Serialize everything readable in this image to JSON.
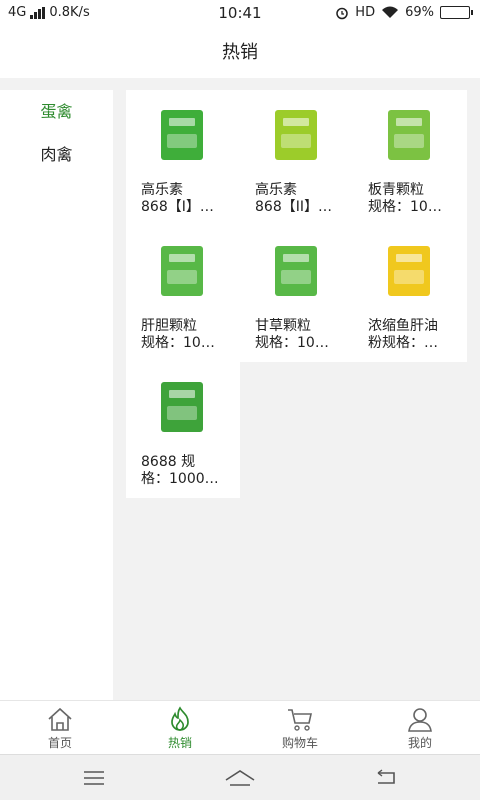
{
  "status_bar": {
    "network": "4G",
    "speed": "0.8K/s",
    "time": "10:41",
    "hd": "HD",
    "battery": "69%",
    "battery_level": 0.69
  },
  "header": {
    "title": "热销"
  },
  "sidebar": {
    "items": [
      {
        "label": "蛋禽",
        "active": true
      },
      {
        "label": "肉禽",
        "active": false
      }
    ]
  },
  "products": [
    {
      "name": "高乐素",
      "spec": "868【I】…",
      "thumb_color": "#3fae3a"
    },
    {
      "name": "高乐素",
      "spec": "868【II】…",
      "thumb_color": "#9ccc2a"
    },
    {
      "name": "板青颗粒",
      "spec": "规格：10…",
      "thumb_color": "#7cc242"
    },
    {
      "name": "肝胆颗粒",
      "spec": "规格：10…",
      "thumb_color": "#58b847"
    },
    {
      "name": "甘草颗粒",
      "spec": "规格：10…",
      "thumb_color": "#58b847"
    },
    {
      "name": "浓缩鱼肝油",
      "spec": "粉规格：…",
      "thumb_color": "#f0c81e"
    },
    {
      "name": "8688 规",
      "spec": "格：1000…",
      "thumb_color": "#3ea33a"
    }
  ],
  "tabbar": {
    "tabs": [
      {
        "label": "首页",
        "icon": "home-icon",
        "active": false
      },
      {
        "label": "热销",
        "icon": "fire-icon",
        "active": true
      },
      {
        "label": "购物车",
        "icon": "cart-icon",
        "active": false
      },
      {
        "label": "我的",
        "icon": "user-icon",
        "active": false
      }
    ]
  },
  "colors": {
    "accent": "#2e8b2e",
    "background": "#f2f2f2"
  }
}
